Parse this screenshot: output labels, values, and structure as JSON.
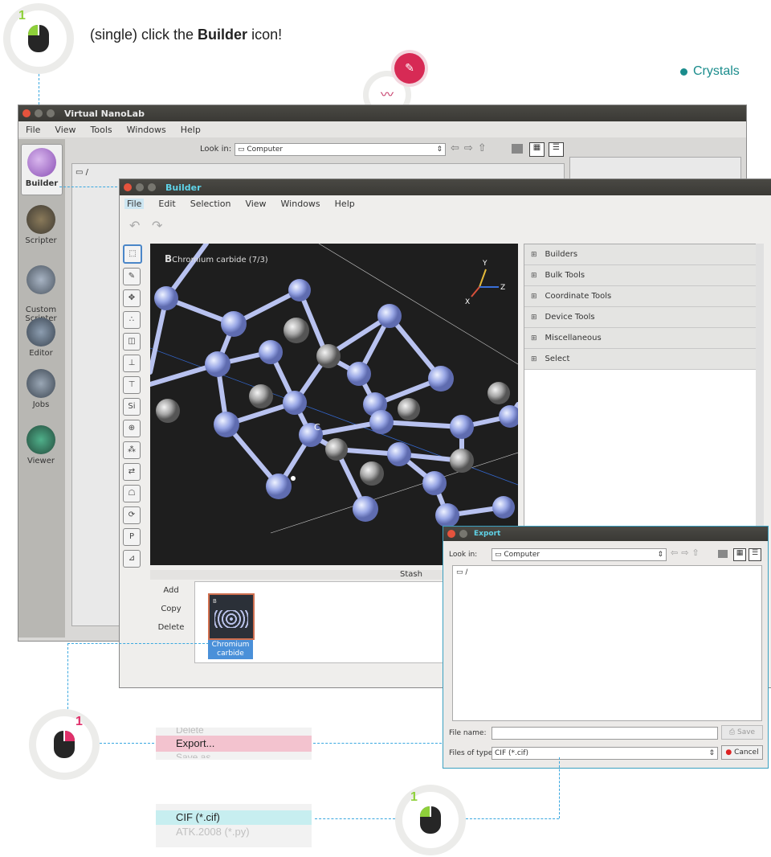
{
  "instruction": {
    "step": "1",
    "prefix": "(single) click the ",
    "bold": "Builder",
    "suffix": " icon!"
  },
  "crystals_label": "Crystals",
  "colors": {
    "accent_teal": "#1a8c8c",
    "accent_pink": "#e0306a",
    "accent_green": "#8ed03a",
    "connector_blue": "#3aa8e0"
  },
  "main_window": {
    "title": "Virtual NanoLab",
    "menu": [
      "File",
      "View",
      "Tools",
      "Windows",
      "Help"
    ],
    "look_in_label": "Look in:",
    "look_in_value": "Computer",
    "path": "/",
    "sidebar": [
      {
        "label": "Builder",
        "icon": "builder-icon"
      },
      {
        "label": "Scripter",
        "icon": "scripter-icon"
      },
      {
        "label": "Custom\nScripter",
        "icon": "custom-scripter-icon"
      },
      {
        "label": "Editor",
        "icon": "editor-icon"
      },
      {
        "label": "Jobs",
        "icon": "jobs-icon"
      },
      {
        "label": "Viewer",
        "icon": "viewer-icon"
      }
    ]
  },
  "builder_window": {
    "title": "Builder",
    "menu": [
      "File",
      "Edit",
      "Selection",
      "View",
      "Windows",
      "Help"
    ],
    "viewport_label": "Chromium carbide (7/3)",
    "viewport_letter": "B",
    "atom_label": "C",
    "axes": [
      "Y",
      "X",
      "Z"
    ],
    "panels": [
      "Builders",
      "Bulk Tools",
      "Coordinate Tools",
      "Device Tools",
      "Miscellaneous",
      "Select"
    ],
    "stash_label": "Stash",
    "stash_buttons": [
      "Add",
      "Copy",
      "Delete"
    ],
    "stash_item": "Chromium\ncarbide",
    "stash_thumb_letter": "B"
  },
  "export_dialog": {
    "title": "Export",
    "look_in_label": "Look in:",
    "look_in_value": "Computer",
    "path": "/",
    "file_name_label": "File name:",
    "file_name_value": "",
    "files_of_type_label": "Files of type:",
    "files_of_type_value": "CIF (*.cif)",
    "save_button": "Save",
    "cancel_button": "Cancel"
  },
  "context_menu": {
    "above": "Delete",
    "selected": "Export...",
    "below": "Save as"
  },
  "type_menu": {
    "selected": "CIF (*.cif)",
    "other": "ATK.2008 (*.py)"
  },
  "badges": {
    "top": "1",
    "left": "1",
    "bottom": "1"
  }
}
